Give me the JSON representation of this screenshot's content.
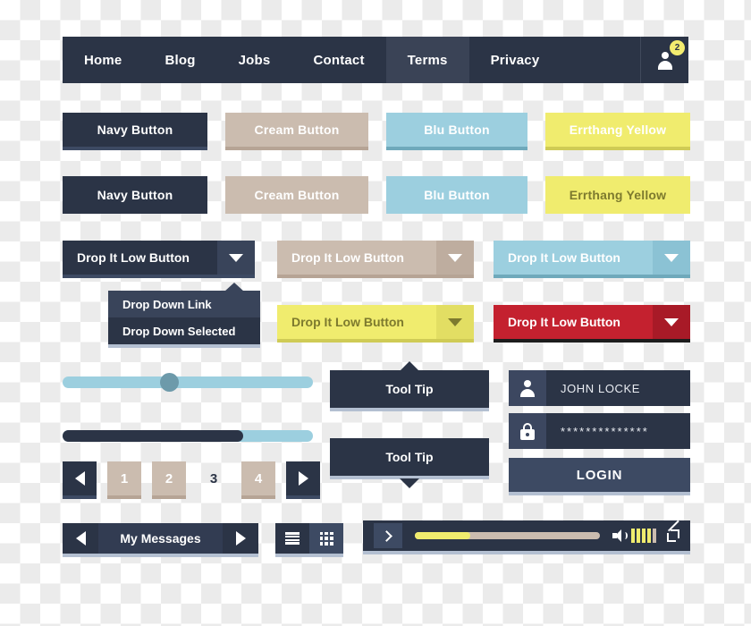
{
  "navbar": {
    "items": [
      {
        "label": "Home",
        "active": false
      },
      {
        "label": "Blog",
        "active": false
      },
      {
        "label": "Jobs",
        "active": false
      },
      {
        "label": "Contact",
        "active": false
      },
      {
        "label": "Terms",
        "active": true
      },
      {
        "label": "Privacy",
        "active": false
      }
    ],
    "avatar_icon": "user-icon",
    "badge_count": "2",
    "badge_color": "#f3ec6f",
    "bg_color": "#2b3446",
    "active_bg_color": "#3a4356"
  },
  "buttons_row_1": [
    {
      "label": "Navy Button",
      "color": "#2b3446"
    },
    {
      "label": "Cream Button",
      "color": "#cbbcaf"
    },
    {
      "label": "Blu Button",
      "color": "#9ccfdf"
    },
    {
      "label": "Errthang Yellow",
      "color": "#f0ec6e"
    }
  ],
  "buttons_row_2": [
    {
      "label": "Navy Button",
      "color": "#2b3446"
    },
    {
      "label": "Cream Button",
      "color": "#cbbcaf"
    },
    {
      "label": "Blu Button",
      "color": "#9ccfdf"
    },
    {
      "label": "Errthang Yellow",
      "color": "#f0ec6e"
    }
  ],
  "dropdowns": {
    "navy": {
      "label": "Drop It Low Button",
      "caret": "chevron-down-icon"
    },
    "cream": {
      "label": "Drop It Low Button",
      "caret": "chevron-down-icon"
    },
    "blue": {
      "label": "Drop It Low Button",
      "caret": "chevron-down-icon"
    },
    "yellow": {
      "label": "Drop It Low Button",
      "caret": "chevron-down-icon"
    },
    "red": {
      "label": "Drop It Low Button",
      "caret": "chevron-down-icon",
      "color": "#c4212f"
    }
  },
  "dropdown_menu": {
    "items": [
      {
        "label": "Drop Down Link",
        "selected": false
      },
      {
        "label": "Drop Down Selected",
        "selected": true
      }
    ]
  },
  "sliders": {
    "handle_slider": {
      "value_percent": 39,
      "track_color": "#9ccfdf",
      "knob_color": "#6d9aaa"
    },
    "progress_slider": {
      "value_percent": 72,
      "fill_color": "#2b3446",
      "track_color": "#9ccfdf"
    }
  },
  "pagination": {
    "prev_icon": "triangle-left-icon",
    "next_icon": "triangle-right-icon",
    "pages": [
      {
        "label": "1",
        "current": false
      },
      {
        "label": "2",
        "current": false
      },
      {
        "label": "3",
        "current": true
      },
      {
        "label": "4",
        "current": false
      }
    ]
  },
  "tooltips": [
    {
      "label": "Tool Tip",
      "arrow": "up"
    },
    {
      "label": "Tool Tip",
      "arrow": "down"
    }
  ],
  "login": {
    "username_icon": "user-icon",
    "username_value": "JOHN LOCKE",
    "password_icon": "lock-icon",
    "password_value": "**************",
    "submit_label": "LOGIN"
  },
  "messages_bar": {
    "prev_icon": "triangle-left-icon",
    "title": "My Messages",
    "next_icon": "triangle-right-icon"
  },
  "view_toggle": {
    "list_icon": "list-view-icon",
    "grid_icon": "grid-view-icon"
  },
  "player": {
    "play_icon": "play-chevron-icon",
    "progress_percent": 30,
    "progress_color": "#f0ec6e",
    "track_color": "#cbbcaf",
    "speaker_icon": "speaker-icon",
    "volume_bars": [
      "#f0ec6e",
      "#f0ec6e",
      "#f0ec6e",
      "#f0ec6e",
      "#cbbcaf"
    ],
    "fullscreen_icon": "fullscreen-icon"
  }
}
